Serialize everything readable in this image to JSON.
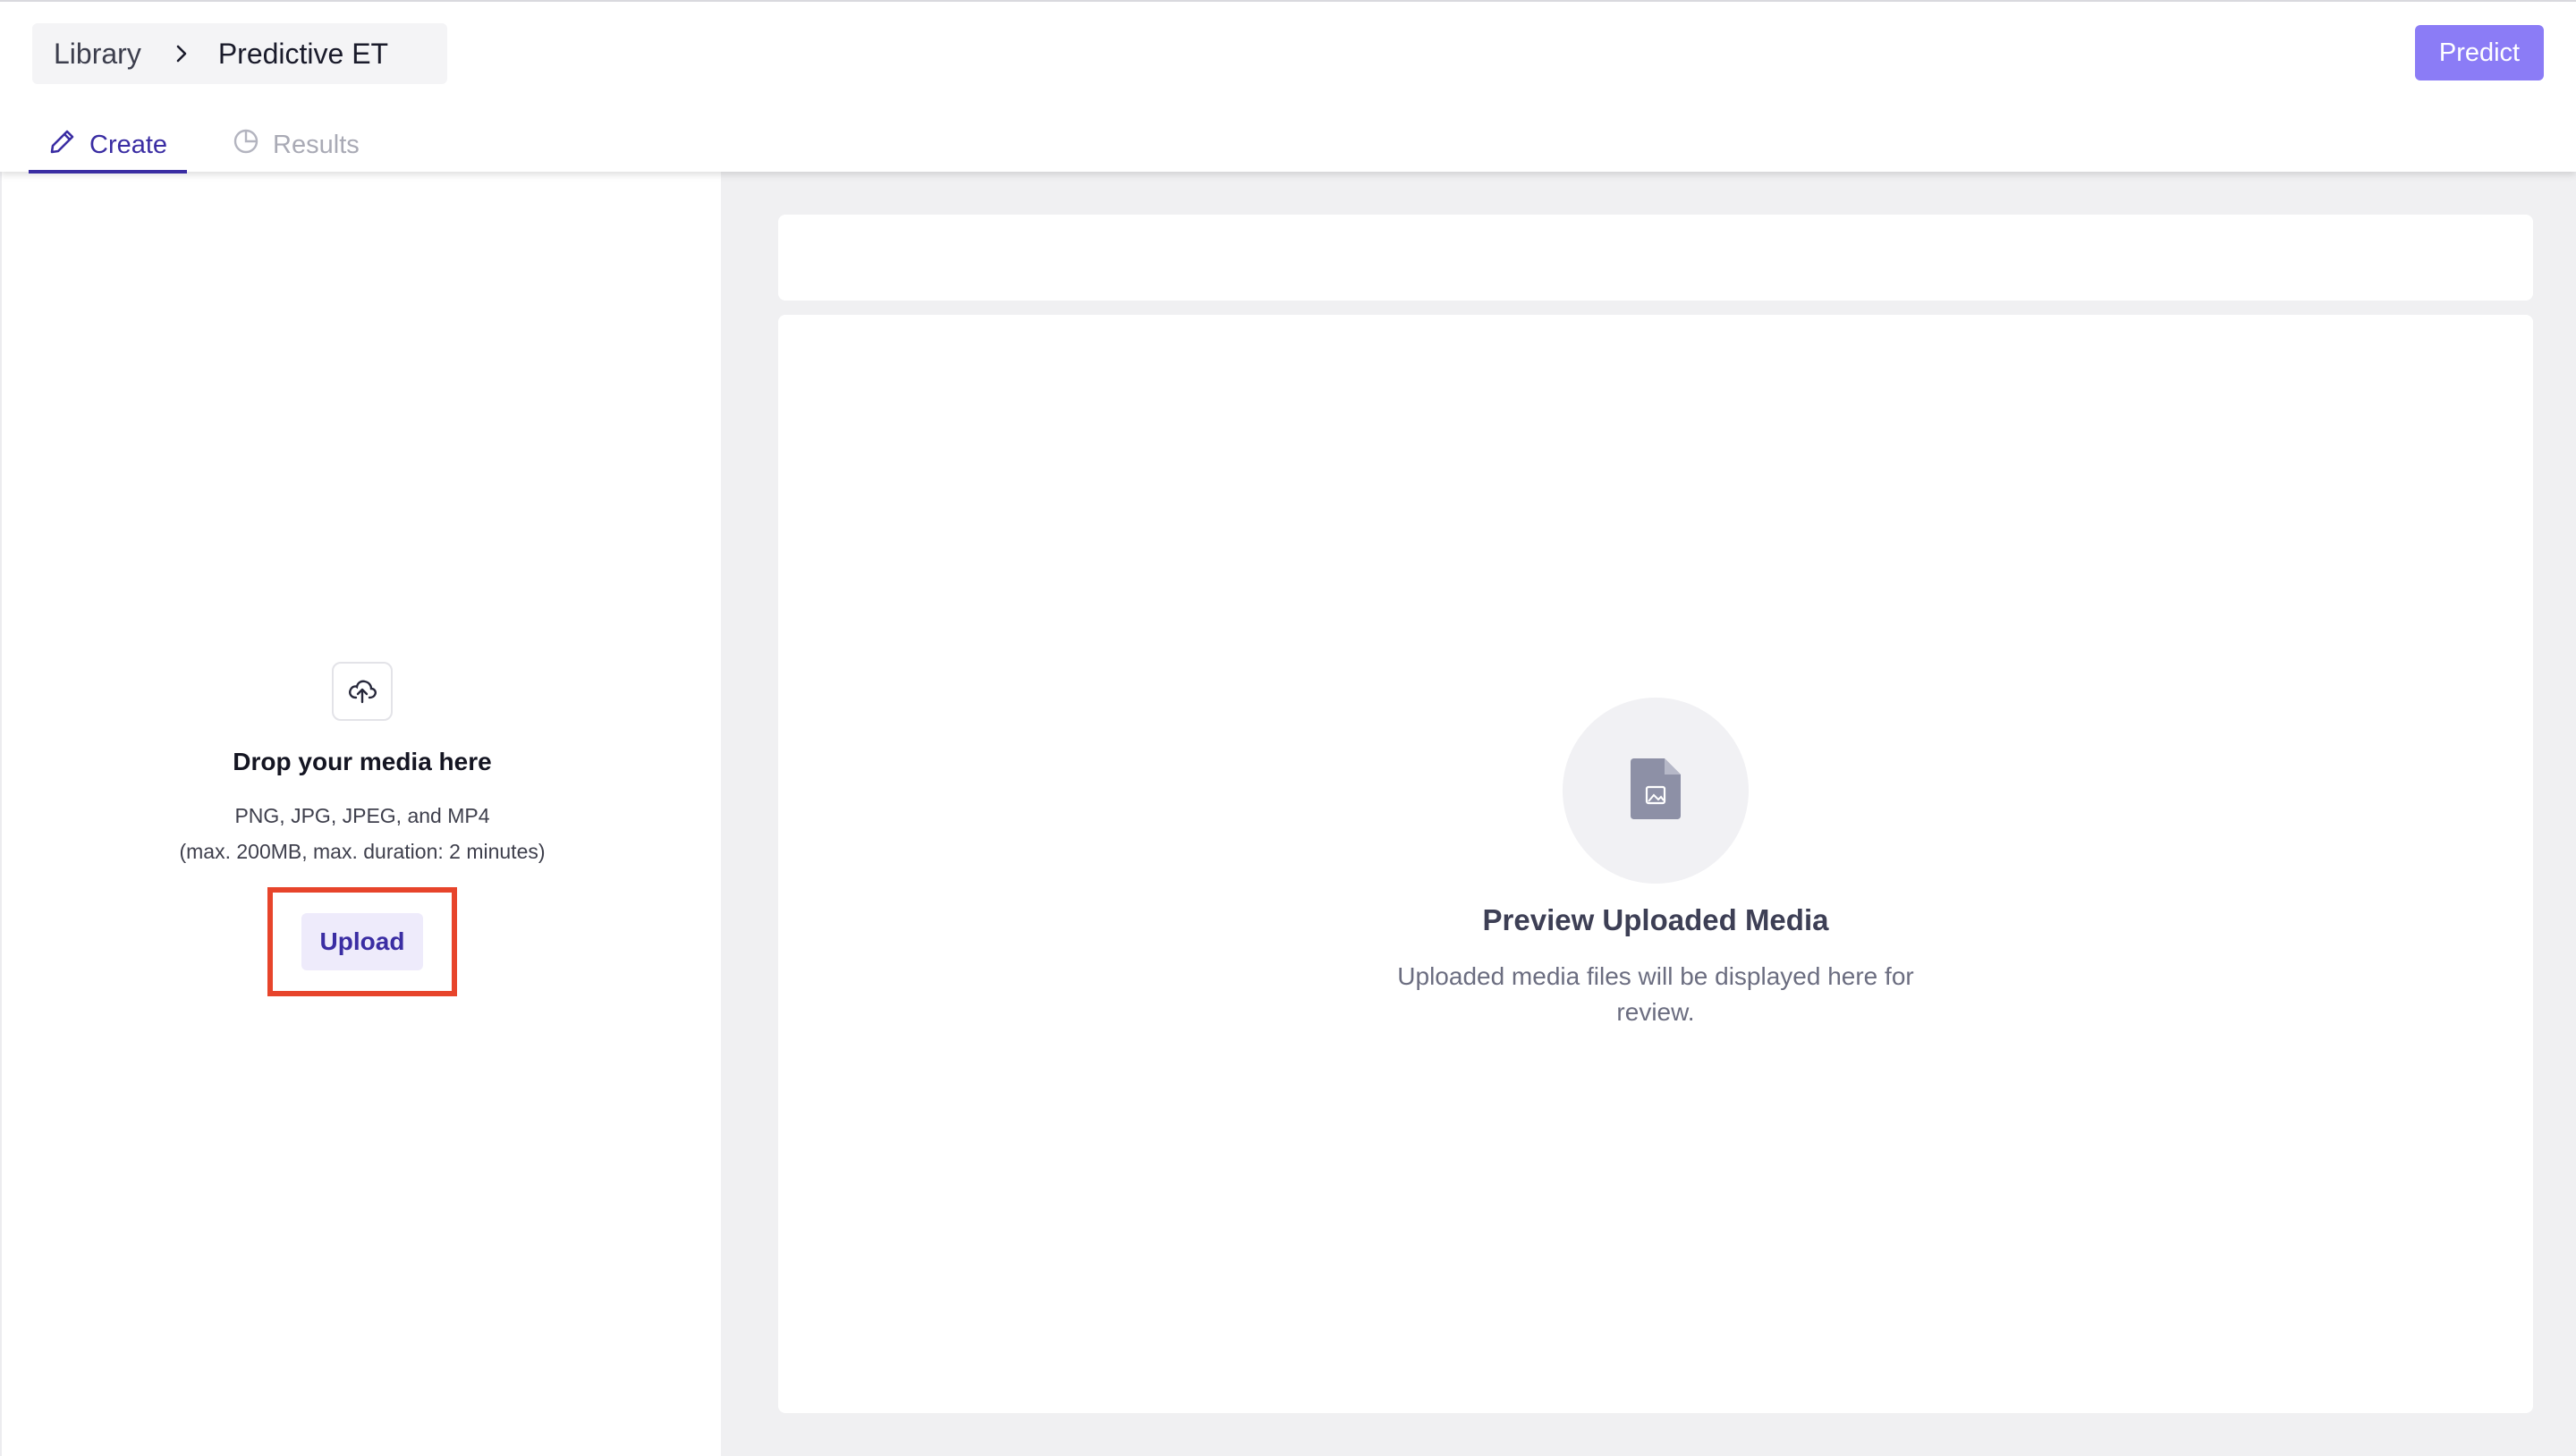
{
  "header": {
    "breadcrumb": {
      "library": "Library",
      "current": "Predictive ET"
    },
    "predict_label": "Predict",
    "tabs": [
      {
        "label": "Create",
        "icon": "pencil-icon",
        "active": true
      },
      {
        "label": "Results",
        "icon": "pie-chart-icon",
        "active": false
      }
    ]
  },
  "upload": {
    "icon": "cloud-upload-icon",
    "title": "Drop your media here",
    "formats": "PNG, JPG, JPEG, and MP4",
    "limits": "(max. 200MB, max. duration: 2 minutes)",
    "button_label": "Upload"
  },
  "preview": {
    "icon": "image-file-icon",
    "title": "Preview Uploaded Media",
    "subtitle": "Uploaded media files will be displayed here for review."
  },
  "colors": {
    "accent": "#3a2da3",
    "predict_button": "#8b7cf6",
    "highlight_box": "#e7442b",
    "upload_button_bg": "#eeebfb"
  }
}
